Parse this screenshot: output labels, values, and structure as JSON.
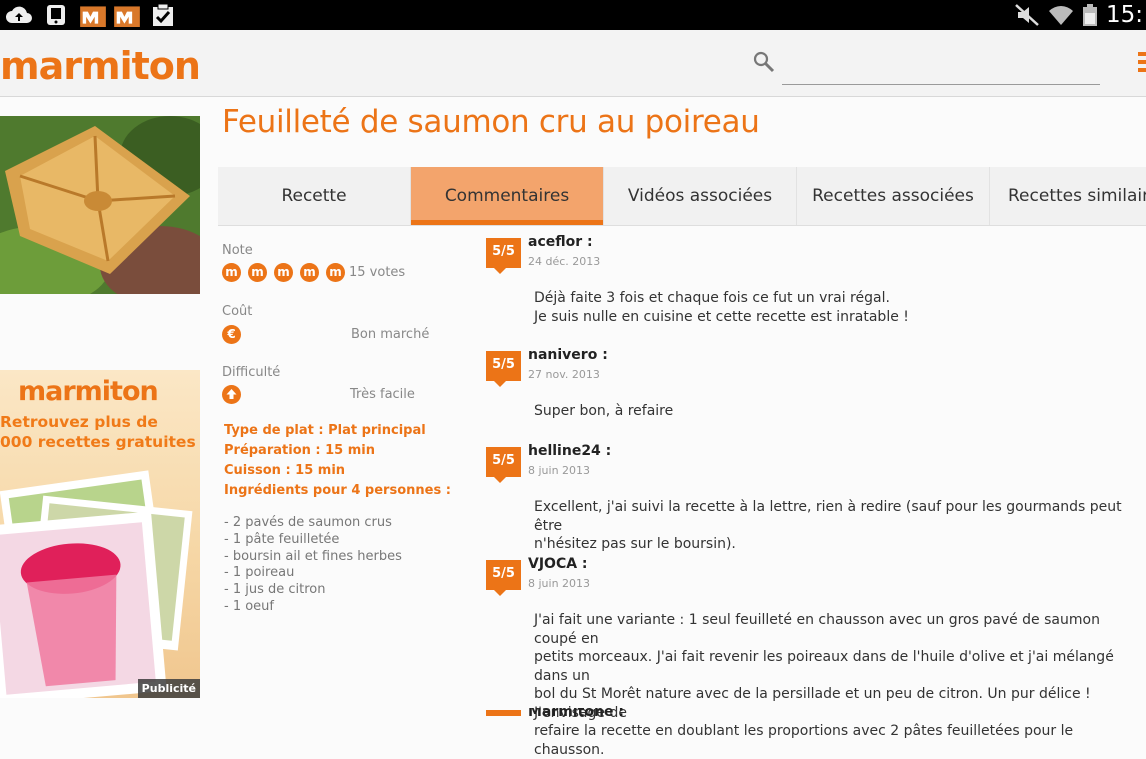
{
  "status_bar": {
    "time": "15:",
    "notification_icons": [
      "upload-icon",
      "phone-icon",
      "marmiton-app-icon",
      "marmiton-app-icon",
      "clipboard-check-icon"
    ],
    "system_icons": [
      "mute-icon",
      "wifi-icon",
      "battery-icon"
    ]
  },
  "header": {
    "logo": "marmiton",
    "search_placeholder": "",
    "brand_color": "#ec7417"
  },
  "recipe": {
    "title": "Feuilleté de saumon cru au poireau",
    "tabs": [
      {
        "label": "Recette",
        "active": false
      },
      {
        "label": "Commentaires",
        "active": true
      },
      {
        "label": "Vidéos associées",
        "active": false
      },
      {
        "label": "Recettes associées",
        "active": false
      },
      {
        "label": "Recettes similaires",
        "active": false
      }
    ],
    "note": {
      "label": "Note",
      "rating": 5,
      "votes": "15 votes"
    },
    "cost": {
      "label": "Coût",
      "value": "Bon marché"
    },
    "difficulty": {
      "label": "Difficulté",
      "value": "Très facile"
    },
    "details": [
      "Type de plat : Plat principal",
      "Préparation : 15 min",
      "Cuisson : 15 min",
      "Ingrédients pour 4 personnes :"
    ],
    "ingredients": [
      "- 2 pavés de saumon crus",
      "- 1 pâte feuilletée",
      "- boursin ail et fines herbes",
      "- 1 poireau",
      "- 1 jus de citron",
      "- 1 oeuf"
    ]
  },
  "ad": {
    "logo": "marmiton",
    "text": "Retrouvez plus de\n000 recettes gratuites !",
    "label": "Publicité"
  },
  "comments": [
    {
      "rating": "5/5",
      "author": "aceflor :",
      "date": "24 déc. 2013",
      "text": "Déjà faite 3 fois et chaque fois ce fut un vrai régal.\nJe suis nulle en cuisine et cette recette est inratable !"
    },
    {
      "rating": "5/5",
      "author": "nanivero :",
      "date": "27 nov. 2013",
      "text": "Super bon, à refaire"
    },
    {
      "rating": "5/5",
      "author": "helline24 :",
      "date": "8 juin 2013",
      "text": "Excellent, j'ai suivi la recette à la lettre, rien à redire (sauf pour les gourmands peut être\nn'hésitez pas sur le boursin)."
    },
    {
      "rating": "5/5",
      "author": "VJOCA :",
      "date": "8 juin 2013",
      "text": "J'ai fait une variante : 1 seul feuilleté en chausson avec un gros pavé de saumon coupé en\npetits morceaux. J'ai fait revenir les poireaux dans de l'huile d'olive et j'ai mélangé dans un\nbol du St Morêt nature avec de la persillade et un peu de citron. Un pur délice ! J'envisage de\nrefaire la recette en doublant les proportions avec 2 pâtes feuilletées pour le chausson."
    },
    {
      "rating": "",
      "author": "Marmitone :",
      "date": "",
      "text": ""
    }
  ]
}
